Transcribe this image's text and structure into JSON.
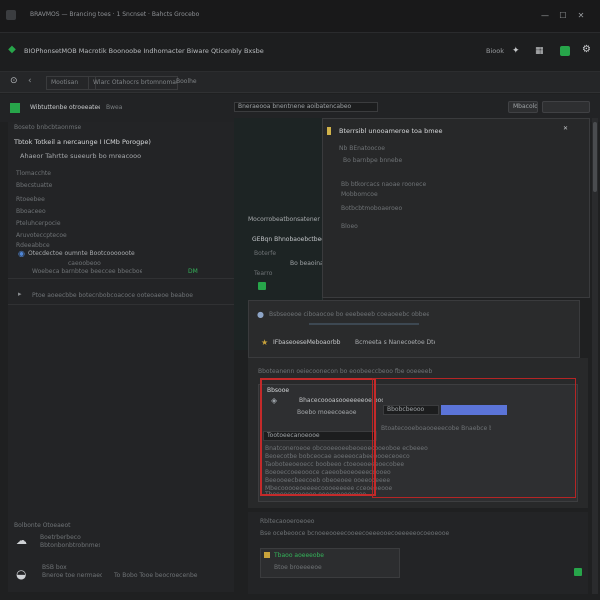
{
  "titlebar": {
    "title": "BRAVMOS — Brancing toes · 1 Sncnset · Bahcts Grocebo",
    "minimize_label": "—",
    "maximize_label": "☐",
    "close_label": "✕"
  },
  "header": {
    "app_title": "BIOPhonsetMOB Macrotik Boonoobe Indhomacter Biware Qticenbly Bxsbe",
    "right_label": "Biook",
    "brand_color": "#27a54a"
  },
  "toolbar": {
    "items": [
      "Mootisan",
      "Wlarc Otahocrs brtomnomaotiyon",
      "Boolhe"
    ]
  },
  "subbar": {
    "title": "Wibtuttenbe otroeeatee",
    "tab": "Bwea",
    "filter_placeholder": "Bneraeooa bnentnene aoibatencabeo",
    "button_label": "Mbacoloe"
  },
  "left_panel": {
    "header": "Boseto bnbcbtaonmse",
    "line_1": "Tbtok Totkeil a nercaunge I ICMb  Porogpe)",
    "line_2": "Ahaeor Tahrtte sueeurb bo mreacooo",
    "list_items": [
      "Tlomacchte",
      "Bbecstuatte",
      "Rtoeebee",
      "Bboaceeo",
      "Pteluhcerpocie",
      "Aruvoteccptecoe",
      "Rdeeabbce"
    ],
    "link_1": "Otecdectoe oumnte Bootcoooooote",
    "link_1_sub": "caeoobeoo",
    "link_1_detail": "Woebeca barnbtoe beeccee bbecboeantoee",
    "link_1_badge": "DM",
    "link_2": "Ptoe aoeecbbe botecnbobcoacoce ooteoaeoe beaboe",
    "footer_title": "Bolbonte Otoeaeot",
    "footer_item_1": "Boetrberbeco",
    "footer_item_2": "Bbtonbonbtrobnmes",
    "footer_item_3": "BSB box",
    "footer_item_4": "Bneroe toe nermaeoenb",
    "footer_mid": "To Bobo  Tooe beocroecenbe"
  },
  "center_panel": {
    "line_1": "Mocorrobeatbonsatenen",
    "line_2": "GEBqn  Bhnobaoebctbeoo DBr",
    "line_3": "Boterfe",
    "line_4": "Bo beaoinasse",
    "line_5": "Tearro"
  },
  "right_card": {
    "title": "Bterrsibl unooameroe toa bmee",
    "line_1": "Nb BEnatoocoe",
    "line_2": "Bo barnbpe bnnebe",
    "line_3": "Bb btkorcacs naoae roonece",
    "line_4": "Mobbomcoe",
    "line_5": "Botbcbtmoboaeroeo",
    "line_6": "Bloeo",
    "close_label": "✕"
  },
  "mid_panel": {
    "line_1": "Bsbseoeoe ciboaocoe bo eeebeeeb coeaoeebc obbeeo",
    "chip_label": "IFbaseoeseMeboaorbb",
    "chip_right": "Bcmeeta s Nanecoetoe Dtecrobeco",
    "line_2": "Bboteanenn oeiecoonecon bo eoobeeccbeoo fbe ooeeeeb"
  },
  "dialog": {
    "title": "Bbsooe",
    "field_label": "Bhacecoooasooeeeeeoe bocaeceeo",
    "field_value": "Boebo moeecoeaoe",
    "right_label": "Bbobcbeooo",
    "primary_button": "",
    "section_label": "Tootoeecanoeooe",
    "section_detail": "Btoatecooeboaooeeecobe  Bnaebce bomoe",
    "body_lines": [
      "Bnatconeroeoe obcooeeoeebeoeoecooeoboe ecbeeeo",
      "Beoecotbe bobceocae aoeeeocabeeoooeceoeco",
      "Taoboteeoeoecc boobeeo ctoeoeoeeeoecobee",
      "Boeoeccoeeoooce caeeobeoeoeeecoooeo",
      "Beeooeecbeecoeb obeoeoee ooeeoceeee",
      "Mbecooooeoeeeecoooeeeeee cceoeeeooe",
      "Tbeoeeeecoeoee ooeeeeeooeoeo"
    ]
  },
  "bottom_panel": {
    "line_1": "Rbltecaooeroeoeo",
    "line_2": "Bse ocebeooce bcnoeeooeecooeecoeeeooecoeeeeeocoeoeooe",
    "chip_label": "Tbaoo aoeeeobe",
    "line_3": "Btoe broeeeeoe"
  },
  "colors": {
    "accent_green": "#27a54a",
    "highlight_red": "#c42a2a",
    "primary_blue": "#5b74d8"
  }
}
